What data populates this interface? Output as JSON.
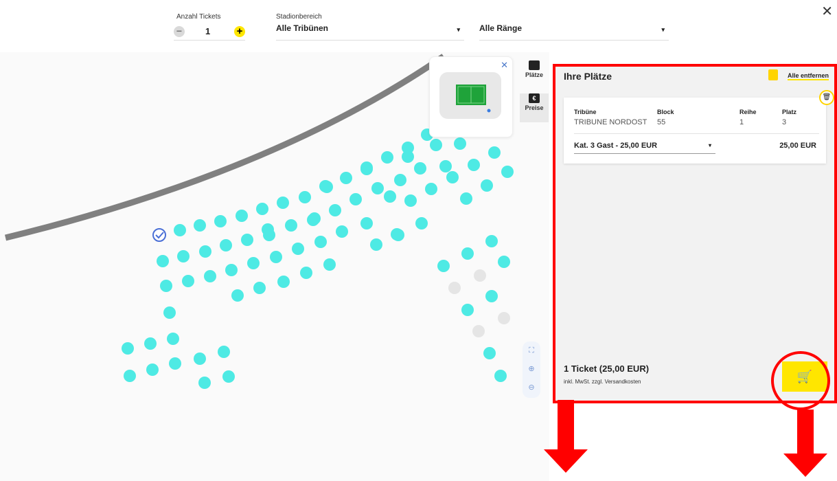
{
  "top": {
    "tickets_label": "Anzahl Tickets",
    "tickets_value": "1",
    "minus_glyph": "−",
    "plus_glyph": "+",
    "area_label": "Stadionbereich",
    "area_value": "Alle Tribünen",
    "rank_value": "Alle Ränge",
    "caret": "▾",
    "close_glyph": "✕"
  },
  "side_tabs": [
    {
      "label": "Plätze",
      "icon": "ticket-icon"
    },
    {
      "label": "Preise",
      "icon": "euro-icon"
    }
  ],
  "minimap": {
    "close_glyph": "✕"
  },
  "zoom": {
    "fit": "⛶",
    "zoom_in": "⊕",
    "zoom_out": "⊖"
  },
  "panel": {
    "title": "Ihre Plätze",
    "remove_all": "Alle entfernen",
    "trash_glyph": "🗑",
    "seat": {
      "headers": {
        "tribune": "Tribüne",
        "block": "Block",
        "row": "Reihe",
        "seat": "Platz"
      },
      "tribune": "TRIBUNE NORDOST",
      "block": "55",
      "row": "1",
      "seat": "3",
      "category": "Kat. 3 Gast - 25,00 EUR",
      "price": "25,00 EUR"
    },
    "total": "1 Ticket (25,00 EUR)",
    "tax_note": "inkl. MwSt. zzgl. Versandkosten",
    "cart_glyph": "🛒"
  },
  "colors": {
    "seat_available": "#4eeae4",
    "seat_unavailable": "#e5e5e5",
    "seat_selected": "#4a6fd6",
    "accent": "#ffe600",
    "annotation": "#ff0000"
  }
}
